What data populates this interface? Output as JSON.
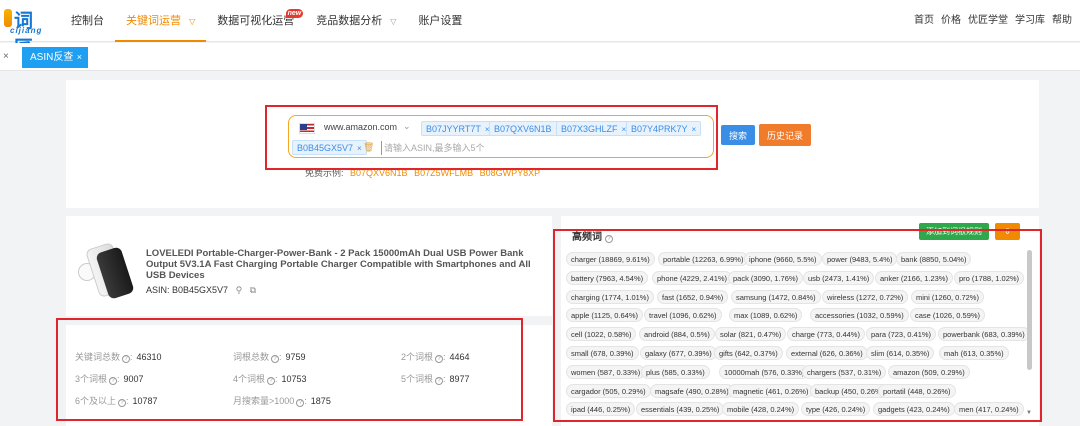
{
  "app": {
    "logo_cn": "词匠",
    "logo_en": "cijiang"
  },
  "nav": {
    "items": [
      {
        "label": "控制台",
        "caret": ""
      },
      {
        "label": "关键词运营",
        "caret": "▽"
      },
      {
        "label": "数据可视化运营",
        "caret": "",
        "badge": "new"
      },
      {
        "label": "竞品数据分析",
        "caret": "▽"
      },
      {
        "label": "账户设置",
        "caret": ""
      }
    ],
    "right": [
      "首页",
      "价格",
      "优匠学堂",
      "学习库",
      "帮助"
    ]
  },
  "tabs": {
    "close_glyph": "×",
    "active_label": "ASIN反查",
    "active_close": "×"
  },
  "search": {
    "domain": "www.amazon.com",
    "domain_caret": "⌄",
    "chips": [
      "B07JYYRT7T",
      "B07QXV6N1B",
      "B07X3GHLZF",
      "B07Y4PRK7Y",
      "B0B45GX5V7"
    ],
    "chip_close": "×",
    "placeholder": "请输入ASIN,最多输入5个",
    "search_btn": "搜索",
    "history_btn": "历史记录",
    "example_label": "免费示例:",
    "examples": [
      "B07QXV6N1B",
      "B07Z5WFLMB",
      "B08GWPY8XP"
    ]
  },
  "product": {
    "title": "LOVELEDI Portable-Charger-Power-Bank - 2 Pack 15000mAh Dual USB Power Bank Output 5V3.1A Fast Charging Portable Charger Compatible with Smartphones and All USB Devices",
    "asin": "ASIN: B0B45GX5V7"
  },
  "stats": [
    {
      "label": "关键词总数",
      "value": "46310"
    },
    {
      "label": "词根总数",
      "value": "9759"
    },
    {
      "label": "2个词根",
      "value": "4464"
    },
    {
      "label": "3个词根",
      "value": "9007"
    },
    {
      "label": "4个词根",
      "value": "10753"
    },
    {
      "label": "5个词根",
      "value": "8977"
    },
    {
      "label": "6个及以上",
      "value": "10787"
    },
    {
      "label": "月搜索量>1000",
      "value": "1875"
    }
  ],
  "high_freq": {
    "title": "高频词",
    "add_btn": "添加到词根规则",
    "export_btn": "⇩",
    "rows": [
      [
        "charger (18869, 9.61%)",
        "portable (12263, 6.99%)",
        "iphone (9660, 5.5%)",
        "power (9483, 5.4%)",
        "bank (8850, 5.04%)"
      ],
      [
        "battery (7963, 4.54%)",
        "phone (4229, 2.41%)",
        "pack (3090, 1.76%)",
        "usb (2473, 1.41%)",
        "anker (2166, 1.23%)",
        "pro (1788, 1.02%)"
      ],
      [
        "charging (1774, 1.01%)",
        "fast (1652, 0.94%)",
        "samsung (1472, 0.84%)",
        "wireless (1272, 0.72%)",
        "mini (1260, 0.72%)"
      ],
      [
        "apple (1125, 0.64%)",
        "travel (1096, 0.62%)",
        "max (1089, 0.62%)",
        "accessories (1032, 0.59%)",
        "case (1026, 0.59%)"
      ],
      [
        "cell (1022, 0.58%)",
        "android (884, 0.5%)",
        "solar (821, 0.47%)",
        "charge (773, 0.44%)",
        "para (723, 0.41%)",
        "powerbank (683, 0.39%)"
      ],
      [
        "small (678, 0.39%)",
        "galaxy (677, 0.39%)",
        "gifts (642, 0.37%)",
        "external (626, 0.36%)",
        "slim (614, 0.35%)",
        "mah (613, 0.35%)"
      ],
      [
        "women (587, 0.33%)",
        "plus (585, 0.33%)",
        "10000mah (576, 0.33%)",
        "chargers (537, 0.31%)",
        "amazon (509, 0.29%)"
      ],
      [
        "cargador (505, 0.29%)",
        "magsafe (490, 0.28%)",
        "magnetic (461, 0.26%)",
        "backup (450, 0.26%)",
        "portatil (448, 0.26%)"
      ],
      [
        "ipad (446, 0.25%)",
        "essentials (439, 0.25%)",
        "mobile (428, 0.24%)",
        "type (426, 0.24%)",
        "gadgets (423, 0.24%)",
        "men (417, 0.24%)"
      ]
    ]
  },
  "colors": {
    "accent": "#f08a00",
    "primary": "#3a8ee6",
    "highlight_box": "#e0262c"
  }
}
